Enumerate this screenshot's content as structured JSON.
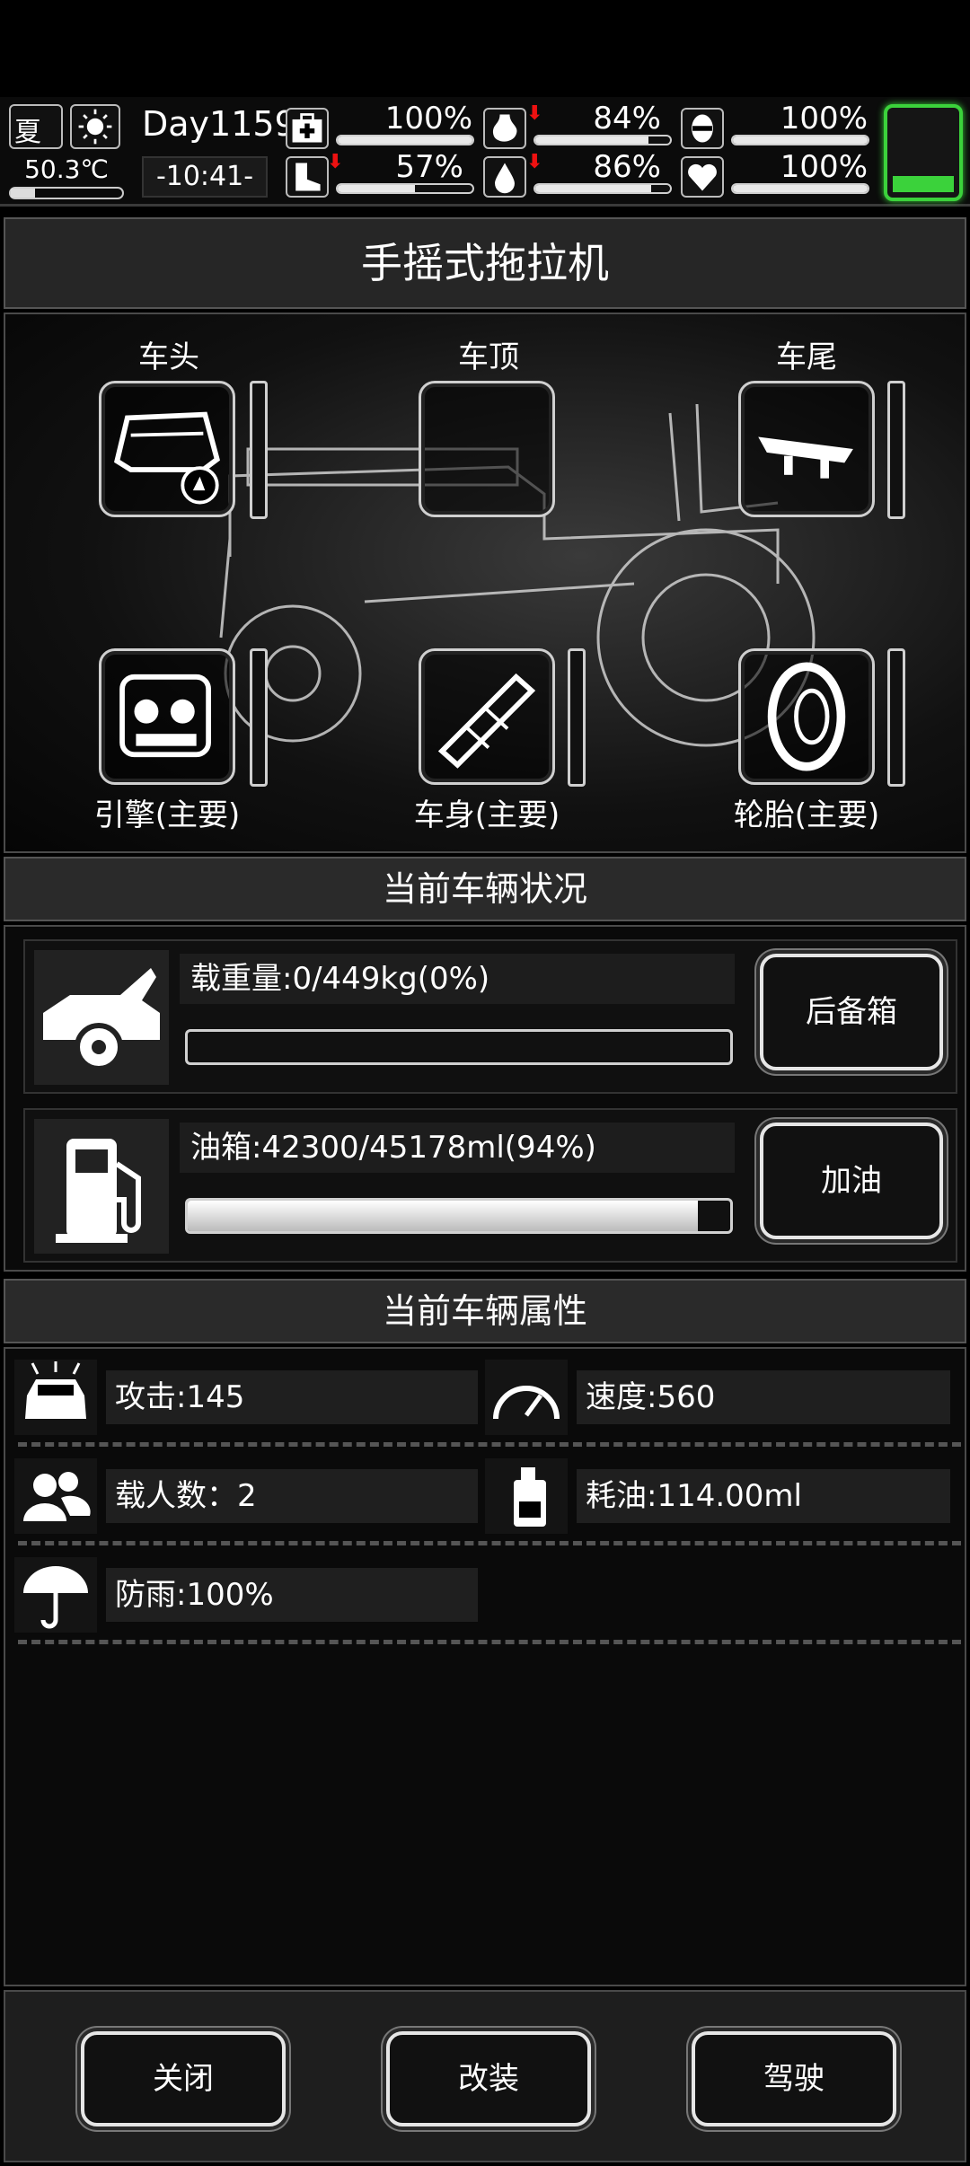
{
  "hud": {
    "season": "夏",
    "temperature": "50.3℃",
    "day": "Day1159",
    "time": "-10:41-",
    "stats": [
      {
        "name": "health",
        "value": "100%",
        "level": 1.0,
        "arrow": false
      },
      {
        "name": "hunger",
        "value": "84%",
        "level": 0.84,
        "arrow": true
      },
      {
        "name": "mood",
        "value": "100%",
        "level": 1.0,
        "arrow": false
      },
      {
        "name": "stamina",
        "value": "57%",
        "level": 0.57,
        "arrow": true
      },
      {
        "name": "thirst",
        "value": "86%",
        "level": 0.86,
        "arrow": true
      },
      {
        "name": "heart",
        "value": "100%",
        "level": 1.0,
        "arrow": false
      }
    ],
    "battery_color": "#3bd23b"
  },
  "vehicle": {
    "name": "手摇式拖拉机",
    "slots": {
      "front": "车头",
      "roof": "车顶",
      "rear": "车尾",
      "engine": "引擎(主要)",
      "body": "车身(主要)",
      "tire": "轮胎(主要)"
    }
  },
  "status": {
    "title": "当前车辆状况",
    "load_text": "载重量:0/449kg(0%)",
    "load_level": 0.0,
    "trunk_button": "后备箱",
    "fuel_text": "油箱:42300/45178ml(94%)",
    "fuel_level": 0.94,
    "refuel_button": "加油"
  },
  "attributes": {
    "title": "当前车辆属性",
    "attack": "攻击:145",
    "speed": "速度:560",
    "passengers": "载人数：2",
    "fuel_use": "耗油:114.00ml",
    "rainproof": "防雨:100%"
  },
  "footer": {
    "close": "关闭",
    "modify": "改装",
    "drive": "驾驶"
  }
}
